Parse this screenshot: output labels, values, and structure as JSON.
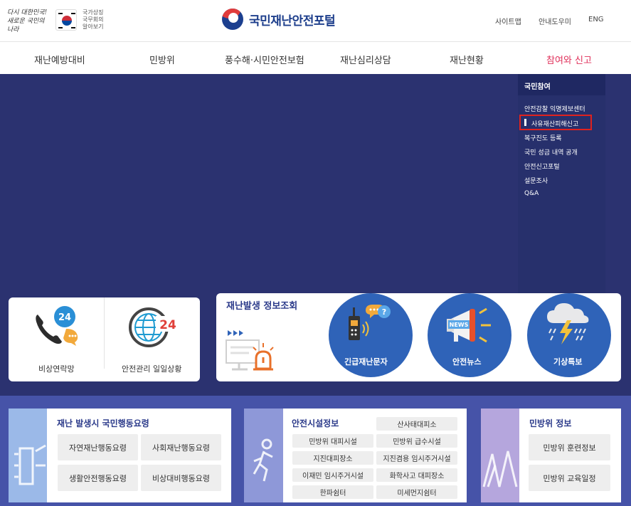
{
  "header": {
    "slogan": "다시 대한민국! 새로운 국민의 나라",
    "flag_text": [
      "국가상징",
      "국무회의",
      "알아보기"
    ],
    "logo": "국민재난안전포털",
    "util_links": [
      "사이트맵",
      "안내도우미",
      "ENG"
    ]
  },
  "gnb": {
    "items": [
      "재난예방대비",
      "민방위",
      "풍수해·시민안전보험",
      "재난심리상담",
      "재난현황",
      "참여와 신고"
    ],
    "active_index": 5,
    "active_color": "#e0305a"
  },
  "dropdown": {
    "title": "국민참여",
    "items": [
      "안전감찰 익명제보센터",
      "사유재산피해신고",
      "복구진도 등록",
      "국민 성금 내역 공개",
      "안전신고포털",
      "설문조사",
      "Q&A"
    ],
    "highlighted_index": 1,
    "highlight_color": "#e0221e"
  },
  "quick": {
    "items": [
      {
        "label": "비상연락망",
        "icon": "phone-24-icon",
        "badge": "24"
      },
      {
        "label": "안전관리 일일상황",
        "icon": "globe-24-icon",
        "badge": "24"
      }
    ]
  },
  "info": {
    "title": "재난발생 정보조회",
    "circles": [
      {
        "label": "긴급재난문자",
        "icon": "emergency-radio-icon"
      },
      {
        "label": "안전뉴스",
        "icon": "news-megaphone-icon",
        "icon_text": "NEWS"
      },
      {
        "label": "기상특보",
        "icon": "storm-cloud-icon"
      }
    ]
  },
  "cards": {
    "guide": {
      "title": "재난 발생시 국민행동요령",
      "buttons": [
        "자연재난행동요령",
        "사회재난행동요령",
        "생활안전행동요령",
        "비상대비행동요령"
      ]
    },
    "facility": {
      "title": "안전시설정보",
      "buttons": [
        "산사태대피소",
        "민방위 대피시설",
        "민방위 급수시설",
        "지진대피장소",
        "지진겸용 임시주거시설",
        "이재민 임시주거시설",
        "화학사고 대피장소",
        "한파쉼터",
        "미세먼지쉼터"
      ]
    },
    "civil": {
      "title": "민방위 정보",
      "buttons": [
        "민방위 훈련정보",
        "민방위 교육일정"
      ]
    }
  },
  "colors": {
    "visual_bg": "#2b3270",
    "accent_blue": "#2f63b8",
    "title_blue": "#2b3a8a"
  }
}
